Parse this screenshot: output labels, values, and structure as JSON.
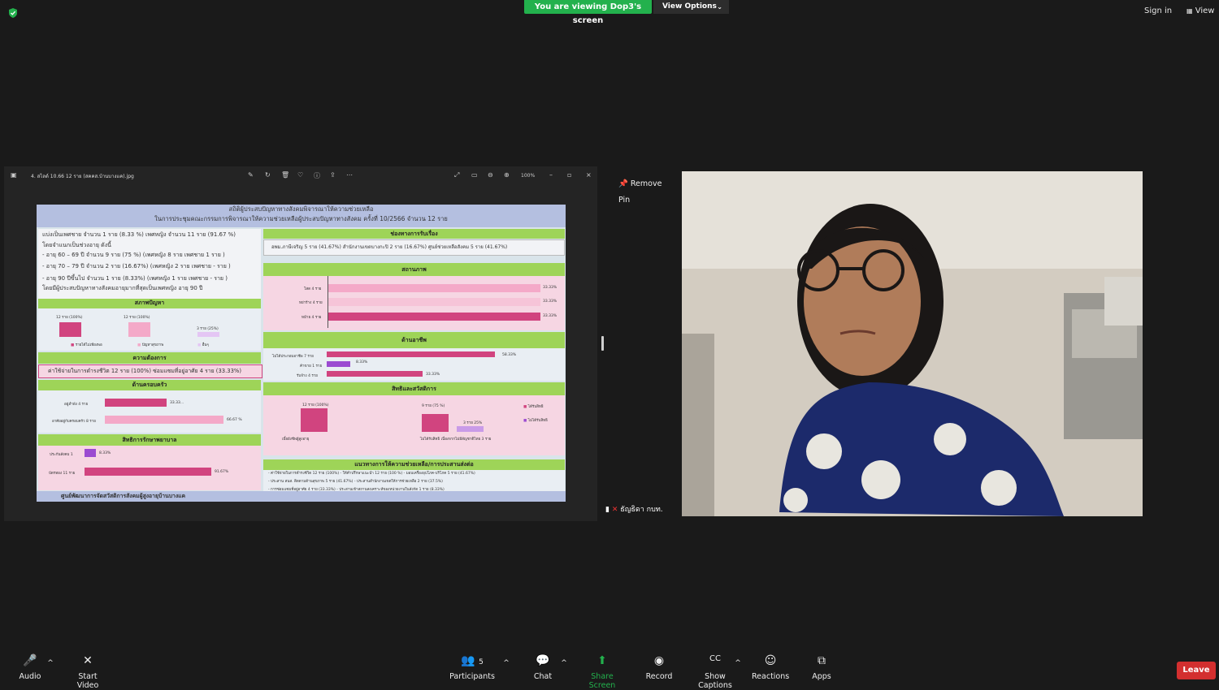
{
  "top": {
    "viewing_banner": "You are viewing Dop3's screen",
    "view_options": "View Options",
    "sign_in": "Sign in",
    "view": "View"
  },
  "share_window": {
    "file_title": "4. สไลด์ 10.66  12 ราย (สคคส.บ้านบางแค).jpg",
    "zoom": "100%"
  },
  "slide": {
    "title1": "สถิติผู้ประสบปัญหาทางสังคมพิจารณาให้ความช่วยเหลือ",
    "title2": "ในการประชุมคณะกรรมการพิจารณาให้ความช่วยเหลือผู้ประสบปัญหาทางสังคม ครั้งที่ 10/2566 จำนวน 12 ราย",
    "info_lines": [
      "แบ่งเป็นเพศชาย จำนวน 1 ราย (8.33 %) เพศหญิง จำนวน 11 ราย (91.67 %)",
      "โดยจำแนกเป็นช่วงอายุ ดังนี้",
      "-  อายุ 60 – 69 ปี จำนวน 9 ราย (75 %) (เพศหญิง 8 ราย  เพศชาย 1 ราย )",
      "-  อายุ 70 – 79 ปี จำนวน 2 ราย (16.67%) (เพศหญิง 2 ราย  เพศชาย - ราย )",
      "-  อายุ 90 ปีขึ้นไป จำนวน 1 ราย (8.33%) (เพศหญิง 1 ราย  เพศชาย - ราย )",
      "โดยมีผู้ประสบปัญหาทางสังคมอายุมากที่สุดเป็นเพศหญิง อายุ 90 ปี"
    ],
    "h_problem": "สภาพปัญหา",
    "h_need": "ความต้องการ",
    "need_text": "ค่าใช้จ่ายในการดำรงชีวิต 12 ราย (100%)  ซ่อมแซมที่อยู่อาศัย 4 ราย (33.33%)",
    "h_family": "ด้านครอบครัว",
    "h_health": "สิทธิการรักษาพยาบาล",
    "h_channel": "ช่องทางการรับเรื่อง",
    "channel_text": "อพม.ภาษีเจริญ 5 ราย (41.67%)   สำนักงานเขตบางกะปิ 2 ราย (16.67%)   ศูนย์ช่วยเหลือสังคม 5 ราย (41.67%)",
    "h_status": "สถานภาพ",
    "h_career": "ด้านอาชีพ",
    "h_welfare": "สิทธิและสวัสดิการ",
    "h_guidance": "แนวทางการให้ความช่วยเหลือ/การประสานส่งต่อ",
    "footer": "ศูนย์พัฒนาการจัดสวัสดิการสังคมผู้สูงอายุบ้านบางแค",
    "problem_labels": [
      "12 ราย (100%)",
      "12 ราย (100%)",
      "3 ราย (25%)"
    ],
    "problem_legend": [
      "รายได้ไม่เพียงพอ",
      "ปัญหาสุขภาพ",
      "อื่นๆ"
    ],
    "status_labels": [
      "โสด 4 ราย",
      "หย่าร้าง 4 ราย",
      "หม้าย 4 ราย"
    ],
    "status_values": [
      "33.33%",
      "33.33%",
      "33.33%"
    ],
    "career_labels": [
      "ไม่ได้ประกอบอาชีพ 7 ราย",
      "ค้าขาย 1 ราย",
      "รับจ้าง 4 ราย"
    ],
    "career_values": [
      "58.33%",
      "8.33%",
      "33.33%"
    ],
    "family_labels": [
      "อยู่ลำพัง 4 ราย",
      "อาศัยอยู่กับครอบครัว 8 ราย"
    ],
    "family_values": [
      "33.33...",
      "66.67 %"
    ],
    "health_labels": [
      "ประกันสังคม 1",
      "บัตรทอง 11 ราย"
    ],
    "health_values": [
      "8.33%",
      "91.67%"
    ],
    "welfare_labels": [
      "12 ราย (100%)",
      "9 ราย (75 %)",
      "3 ราย 25%"
    ],
    "welfare_legend": [
      "ได้รับสิทธิ",
      "ไม่ได้รับสิทธิ"
    ],
    "welfare_captions": [
      "เบี้ยยังชีพผู้สูงอายุ",
      "ไม่ได้รับสิทธิ เนื่องจากไม่มีสัญชาติไทย 3 ราย"
    ],
    "guidance_lines": [
      "- ค่าใช้จ่ายในการดำรงชีวิต 12 ราย (100%)    - ให้คำปรึกษาแนะนำ 12 ราย (100 %)   - มอบเครื่องอุปโภค-บริโภค 5 ราย (41.67%)",
      "- ประสาน สนส. ติดตามด้านสุขภาพ 5 ราย (41.67%)    - ประสานสำนักงานเขตให้การช่วยเหลือ 2 ราย (37.5%)",
      "- การซ่อมแซมที่อยู่อาศัย 4 ราย (33.33%)    - ประสานเข้าสถานสงเคราะห์ของหน่วยงานในสังกัด 1 ราย (8.33%)"
    ]
  },
  "video": {
    "remove_pin": "Remove Pin",
    "participant_name": "ธัญธิดา กบท."
  },
  "toolbar": {
    "audio": "Audio",
    "start_video": "Start Video",
    "participants": "Participants",
    "participants_count": "5",
    "chat": "Chat",
    "share_screen": "Share Screen",
    "record": "Record",
    "show_captions": "Show Captions",
    "reactions": "Reactions",
    "apps": "Apps",
    "leave": "Leave"
  },
  "colors": {
    "share_green": "#23b14d",
    "leave_red": "#d32f2f",
    "slide_green": "#9ed458",
    "bar_magenta": "#d1447f",
    "bar_pink": "#f4a9c8",
    "bar_purple": "#9b4bd1"
  }
}
